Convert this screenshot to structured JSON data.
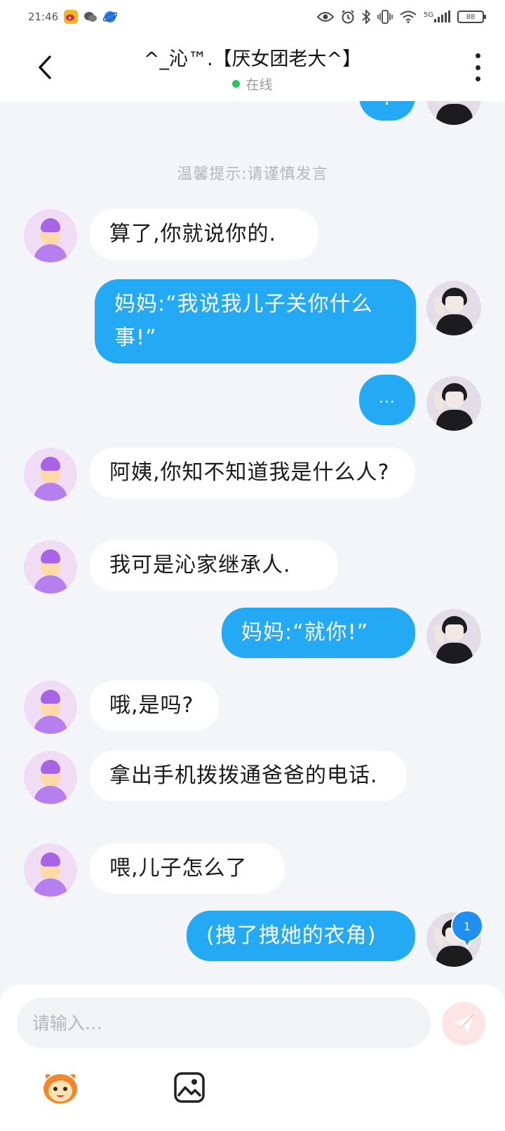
{
  "status_bar": {
    "time": "21:46",
    "network": "5G",
    "battery": "88"
  },
  "header": {
    "title": "^_沁™.【厌女团老大^】",
    "status": "在线"
  },
  "chat": {
    "partial_top_text": "!",
    "notice": "温馨提示:请谨慎发言",
    "messages": [
      {
        "side": "in",
        "text": "算了,你就说你的."
      },
      {
        "side": "out",
        "text": "妈妈:“我说我儿子关你什么事!”"
      },
      {
        "side": "out",
        "text": "..."
      },
      {
        "side": "in",
        "text": "阿姨,你知不知道我是什么人?"
      },
      {
        "side": "in",
        "text": "我可是沁家继承人."
      },
      {
        "side": "out",
        "text": "妈妈:“就你!”"
      },
      {
        "side": "in",
        "text": "哦,是吗?"
      },
      {
        "side": "in",
        "text": "拿出手机拨拨通爸爸的电话."
      },
      {
        "side": "in",
        "text": "喂,儿子怎么了"
      },
      {
        "side": "out",
        "text": "(拽了拽她的衣角)"
      }
    ],
    "badge_count": "1"
  },
  "input": {
    "placeholder": "请输入…"
  },
  "colors": {
    "background": "#f4f5f9",
    "outgoing_bubble": "#24aaf5",
    "incoming_bubble": "#ffffff",
    "online": "#2bc55c",
    "send_button": "#fde4e5"
  },
  "icons": [
    "weibo-icon",
    "wechat-icon",
    "browser-icon",
    "eye-icon",
    "alarm-icon",
    "bluetooth-icon",
    "vibrate-icon",
    "wifi-icon",
    "signal-icon",
    "battery-icon",
    "back-icon",
    "more-icon",
    "send-icon",
    "emoji-icon",
    "image-icon"
  ]
}
